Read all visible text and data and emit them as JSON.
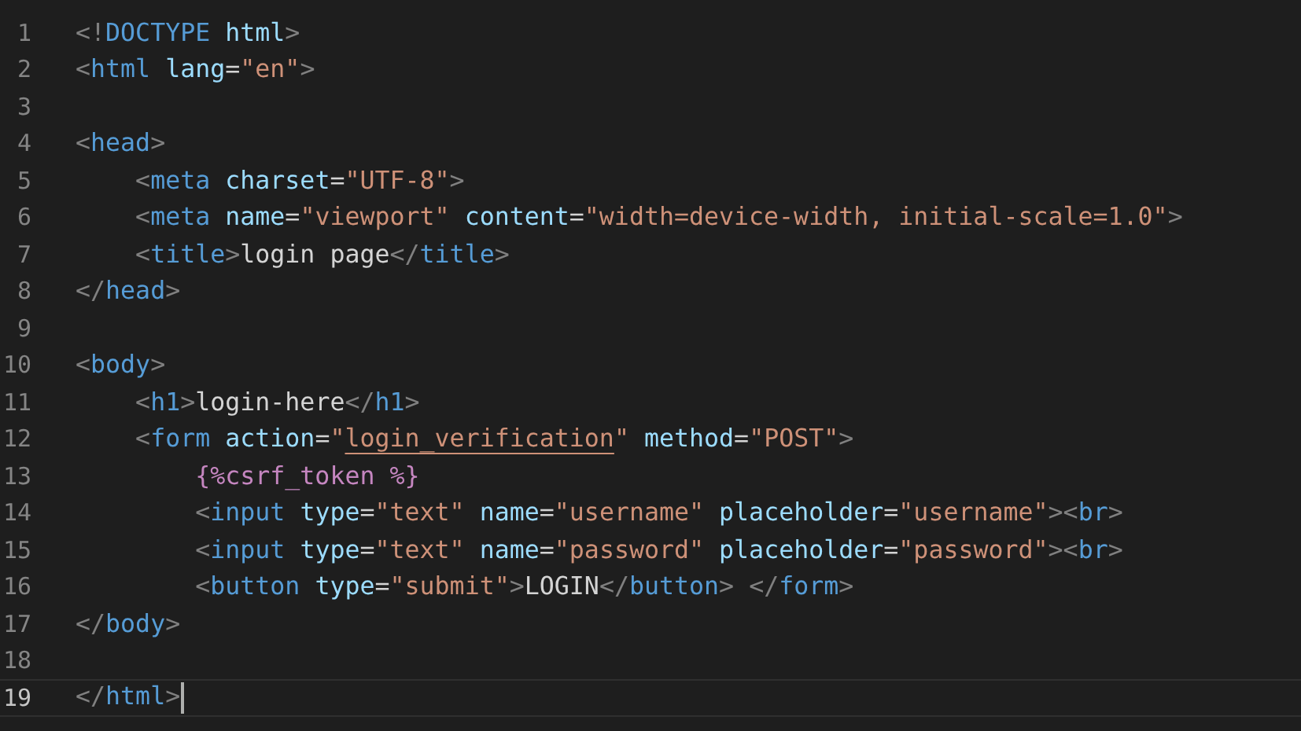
{
  "editor": {
    "lines": [
      {
        "number": "1",
        "current": false,
        "text": "<!DOCTYPE html>"
      },
      {
        "number": "2",
        "current": false,
        "text": "<html lang=\"en\">"
      },
      {
        "number": "3",
        "current": false
      },
      {
        "number": "4",
        "current": false,
        "text": "<head>"
      },
      {
        "number": "5",
        "current": false,
        "text": "    <meta charset=\"UTF-8\">"
      },
      {
        "number": "6",
        "current": false,
        "text": "    <meta name=\"viewport\" content=\"width=device-width, initial-scale=1.0\">"
      },
      {
        "number": "7",
        "current": false,
        "text": "    <title>login page</title>"
      },
      {
        "number": "8",
        "current": false,
        "text": "</head>"
      },
      {
        "number": "9",
        "current": false
      },
      {
        "number": "10",
        "current": false,
        "text": "<body>"
      },
      {
        "number": "11",
        "current": false,
        "text": "    <h1>login-here</h1>"
      },
      {
        "number": "12",
        "current": false,
        "underlined": true,
        "text": "    <form action=\"login_verification\" method=\"POST\">"
      },
      {
        "number": "13",
        "current": false,
        "text": "        {%csrf_token %}"
      },
      {
        "number": "14",
        "current": false,
        "text": "        <input type=\"text\" name=\"username\" placeholder=\"username\"><br>"
      },
      {
        "number": "15",
        "current": false,
        "text": "        <input type=\"text\" name=\"password\" placeholder=\"password\"><br>"
      },
      {
        "number": "16",
        "current": false,
        "text": "        <button type=\"submit\">LOGIN</button> </form>"
      },
      {
        "number": "17",
        "current": false,
        "text": "</body>"
      },
      {
        "number": "18",
        "current": false
      },
      {
        "number": "19",
        "current": true,
        "text": "</html>"
      }
    ]
  }
}
